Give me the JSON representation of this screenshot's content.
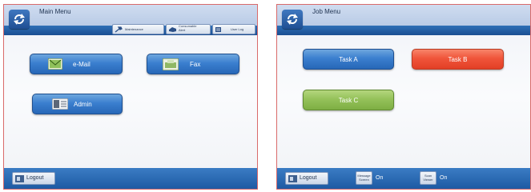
{
  "main_menu": {
    "title": "Main Menu",
    "toolbar": {
      "maintenance_label": "Maintenance",
      "consumable_label": "Consumable Alert",
      "user_log_label": "User Log"
    },
    "buttons": {
      "email_label": "e-Mail",
      "fax_label": "Fax",
      "admin_label": "Admin"
    },
    "logout_label": "Logout"
  },
  "job_menu": {
    "title": "Job Menu",
    "tasks": [
      {
        "label": "Task A",
        "color": "#3b7fcf"
      },
      {
        "label": "Task B",
        "color": "#f0553a"
      },
      {
        "label": "Task C",
        "color": "#95c25a"
      }
    ],
    "logout_label": "Logout",
    "message_screen": {
      "label": "Message Screen",
      "value": "On"
    },
    "scan_viewer": {
      "label": "Scan Viewer",
      "value": "On"
    }
  },
  "colors": {
    "title_bar": "#b9cbe6",
    "accent_blue": "#1d5aa3",
    "frame_border": "#d96a6a"
  }
}
